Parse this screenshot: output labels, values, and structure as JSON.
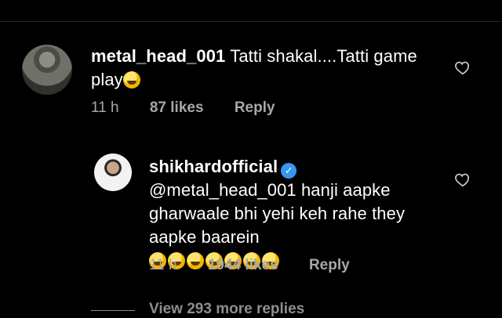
{
  "top_clip": "...",
  "comments": [
    {
      "username": "metal_head_001",
      "text": "Tatti shakal....Tatti game play",
      "time": "11 h",
      "likes": "87 likes",
      "reply_label": "Reply"
    },
    {
      "username": "shikhardofficial",
      "verified": true,
      "mention": "@metal_head_001",
      "text": "hanji aapke gharwaale bhi yehi keh rahe they aapke baarein",
      "time": "11 h",
      "likes": "1944 likes",
      "reply_label": "Reply"
    }
  ],
  "view_more_replies": "View 293 more replies",
  "icons": {
    "heart": "heart-outline-icon",
    "verified": "verified-badge-icon",
    "emoji_laugh": "grinning-squinting-face-emoji",
    "emoji_wink": "winking-face-emoji"
  },
  "colors": {
    "background": "#000000",
    "text_primary": "#ffffff",
    "text_secondary": "#a8a8a8",
    "verified_blue": "#3897f0"
  }
}
